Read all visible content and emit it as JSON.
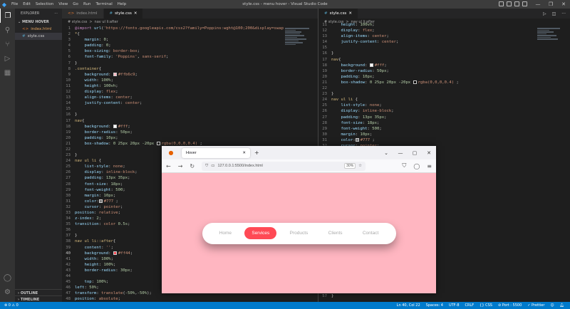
{
  "window": {
    "title": "style.css - menu hover - Visual Studio Code"
  },
  "menu": [
    "File",
    "Edit",
    "Selection",
    "View",
    "Go",
    "Run",
    "Terminal",
    "Help"
  ],
  "sidebar": {
    "header": "EXPLORER",
    "section": "MENU HOVER",
    "files": [
      "index.html",
      "style.css"
    ],
    "outline": "OUTLINE",
    "timeline": "TIMELINE"
  },
  "left_editor": {
    "tabs": [
      "index.html",
      "style.css"
    ],
    "breadcrumb": [
      "# style.css",
      ">",
      "nav ul li:after"
    ]
  },
  "right_editor": {
    "tabs": [
      "style.css"
    ],
    "breadcrumb": [
      "# style.css",
      ">",
      "nav ul li:after"
    ]
  },
  "statusbar": {
    "left": [
      "⊗ 0 ⚠ 0"
    ],
    "right": [
      "Ln 40, Col 22",
      "Spaces: 4",
      "UTF-8",
      "CRLF",
      "{} CSS",
      "⊘ Port : 5500",
      "✓ Prettier"
    ]
  },
  "browser": {
    "tab_title": "Hover",
    "url": "127.0.0.1:5500/index.html",
    "zoom": "30%",
    "nav_items": [
      "Home",
      "Services",
      "Products",
      "Clients",
      "Contact"
    ],
    "active_item": "Services",
    "colors": {
      "page": "#ffb6c1",
      "active": "#ff4a55"
    }
  }
}
